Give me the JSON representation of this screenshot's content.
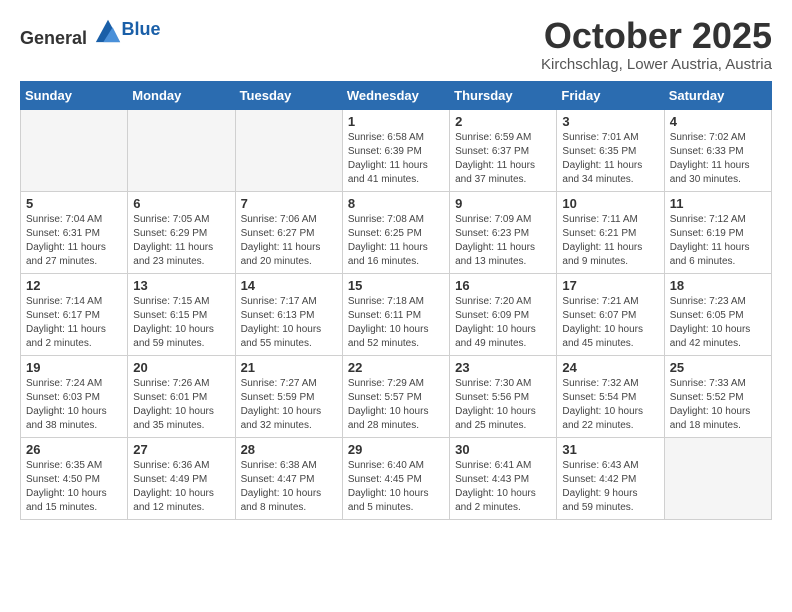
{
  "header": {
    "logo_general": "General",
    "logo_blue": "Blue",
    "month": "October 2025",
    "location": "Kirchschlag, Lower Austria, Austria"
  },
  "calendar": {
    "days_of_week": [
      "Sunday",
      "Monday",
      "Tuesday",
      "Wednesday",
      "Thursday",
      "Friday",
      "Saturday"
    ],
    "weeks": [
      [
        {
          "date": "",
          "info": ""
        },
        {
          "date": "",
          "info": ""
        },
        {
          "date": "",
          "info": ""
        },
        {
          "date": "1",
          "info": "Sunrise: 6:58 AM\nSunset: 6:39 PM\nDaylight: 11 hours\nand 41 minutes."
        },
        {
          "date": "2",
          "info": "Sunrise: 6:59 AM\nSunset: 6:37 PM\nDaylight: 11 hours\nand 37 minutes."
        },
        {
          "date": "3",
          "info": "Sunrise: 7:01 AM\nSunset: 6:35 PM\nDaylight: 11 hours\nand 34 minutes."
        },
        {
          "date": "4",
          "info": "Sunrise: 7:02 AM\nSunset: 6:33 PM\nDaylight: 11 hours\nand 30 minutes."
        }
      ],
      [
        {
          "date": "5",
          "info": "Sunrise: 7:04 AM\nSunset: 6:31 PM\nDaylight: 11 hours\nand 27 minutes."
        },
        {
          "date": "6",
          "info": "Sunrise: 7:05 AM\nSunset: 6:29 PM\nDaylight: 11 hours\nand 23 minutes."
        },
        {
          "date": "7",
          "info": "Sunrise: 7:06 AM\nSunset: 6:27 PM\nDaylight: 11 hours\nand 20 minutes."
        },
        {
          "date": "8",
          "info": "Sunrise: 7:08 AM\nSunset: 6:25 PM\nDaylight: 11 hours\nand 16 minutes."
        },
        {
          "date": "9",
          "info": "Sunrise: 7:09 AM\nSunset: 6:23 PM\nDaylight: 11 hours\nand 13 minutes."
        },
        {
          "date": "10",
          "info": "Sunrise: 7:11 AM\nSunset: 6:21 PM\nDaylight: 11 hours\nand 9 minutes."
        },
        {
          "date": "11",
          "info": "Sunrise: 7:12 AM\nSunset: 6:19 PM\nDaylight: 11 hours\nand 6 minutes."
        }
      ],
      [
        {
          "date": "12",
          "info": "Sunrise: 7:14 AM\nSunset: 6:17 PM\nDaylight: 11 hours\nand 2 minutes."
        },
        {
          "date": "13",
          "info": "Sunrise: 7:15 AM\nSunset: 6:15 PM\nDaylight: 10 hours\nand 59 minutes."
        },
        {
          "date": "14",
          "info": "Sunrise: 7:17 AM\nSunset: 6:13 PM\nDaylight: 10 hours\nand 55 minutes."
        },
        {
          "date": "15",
          "info": "Sunrise: 7:18 AM\nSunset: 6:11 PM\nDaylight: 10 hours\nand 52 minutes."
        },
        {
          "date": "16",
          "info": "Sunrise: 7:20 AM\nSunset: 6:09 PM\nDaylight: 10 hours\nand 49 minutes."
        },
        {
          "date": "17",
          "info": "Sunrise: 7:21 AM\nSunset: 6:07 PM\nDaylight: 10 hours\nand 45 minutes."
        },
        {
          "date": "18",
          "info": "Sunrise: 7:23 AM\nSunset: 6:05 PM\nDaylight: 10 hours\nand 42 minutes."
        }
      ],
      [
        {
          "date": "19",
          "info": "Sunrise: 7:24 AM\nSunset: 6:03 PM\nDaylight: 10 hours\nand 38 minutes."
        },
        {
          "date": "20",
          "info": "Sunrise: 7:26 AM\nSunset: 6:01 PM\nDaylight: 10 hours\nand 35 minutes."
        },
        {
          "date": "21",
          "info": "Sunrise: 7:27 AM\nSunset: 5:59 PM\nDaylight: 10 hours\nand 32 minutes."
        },
        {
          "date": "22",
          "info": "Sunrise: 7:29 AM\nSunset: 5:57 PM\nDaylight: 10 hours\nand 28 minutes."
        },
        {
          "date": "23",
          "info": "Sunrise: 7:30 AM\nSunset: 5:56 PM\nDaylight: 10 hours\nand 25 minutes."
        },
        {
          "date": "24",
          "info": "Sunrise: 7:32 AM\nSunset: 5:54 PM\nDaylight: 10 hours\nand 22 minutes."
        },
        {
          "date": "25",
          "info": "Sunrise: 7:33 AM\nSunset: 5:52 PM\nDaylight: 10 hours\nand 18 minutes."
        }
      ],
      [
        {
          "date": "26",
          "info": "Sunrise: 6:35 AM\nSunset: 4:50 PM\nDaylight: 10 hours\nand 15 minutes."
        },
        {
          "date": "27",
          "info": "Sunrise: 6:36 AM\nSunset: 4:49 PM\nDaylight: 10 hours\nand 12 minutes."
        },
        {
          "date": "28",
          "info": "Sunrise: 6:38 AM\nSunset: 4:47 PM\nDaylight: 10 hours\nand 8 minutes."
        },
        {
          "date": "29",
          "info": "Sunrise: 6:40 AM\nSunset: 4:45 PM\nDaylight: 10 hours\nand 5 minutes."
        },
        {
          "date": "30",
          "info": "Sunrise: 6:41 AM\nSunset: 4:43 PM\nDaylight: 10 hours\nand 2 minutes."
        },
        {
          "date": "31",
          "info": "Sunrise: 6:43 AM\nSunset: 4:42 PM\nDaylight: 9 hours\nand 59 minutes."
        },
        {
          "date": "",
          "info": ""
        }
      ]
    ]
  }
}
